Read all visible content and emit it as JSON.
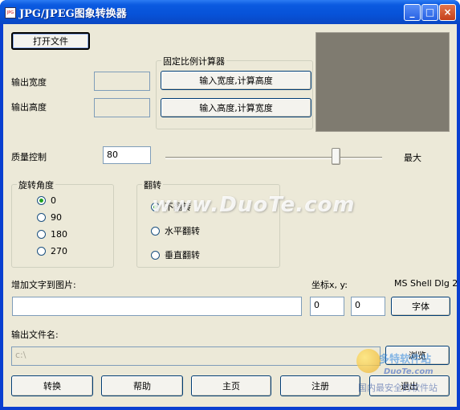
{
  "window": {
    "icon_text": "JPG",
    "title": "JPG/JPEG图象转换器",
    "minimize": "_",
    "maximize": "□",
    "close": "×"
  },
  "open_file_button": "打开文件",
  "output": {
    "width_label": "输出宽度",
    "height_label": "输出高度",
    "width_value": "",
    "height_value": ""
  },
  "ratio_group": {
    "title": "固定比例计算器",
    "calc_height_button": "输入宽度,计算高度",
    "calc_width_button": "输入高度,计算宽度"
  },
  "quality": {
    "label": "质量控制",
    "value": "80",
    "max_label": "最大",
    "slider_level_percent": 80
  },
  "rotate_group": {
    "title": "旋转角度",
    "options": [
      "0",
      "90",
      "180",
      "270"
    ],
    "selected_index": 0
  },
  "flip_group": {
    "title": "翻转",
    "options": [
      "不翻转",
      "水平翻转",
      "垂直翻转"
    ],
    "selected_index": 0
  },
  "add_text": {
    "label": "增加文字到图片:",
    "value": "",
    "coord_label": "坐标x, y:",
    "font_name": "MS Shell Dlg 2",
    "x_value": "0",
    "y_value": "0",
    "font_button": "字体"
  },
  "output_file": {
    "label": "输出文件名:",
    "value": "c:\\",
    "browse_button": "浏览"
  },
  "bottom_buttons": {
    "convert": "转换",
    "help": "帮助",
    "home": "主页",
    "register": "注册",
    "exit": "退出"
  },
  "watermark": {
    "center_text": "www.DuoTe.com",
    "logo_cn": "多特软件站",
    "logo_en": "DuoTe.com",
    "logo_sub": "国内最安全的软件站"
  }
}
